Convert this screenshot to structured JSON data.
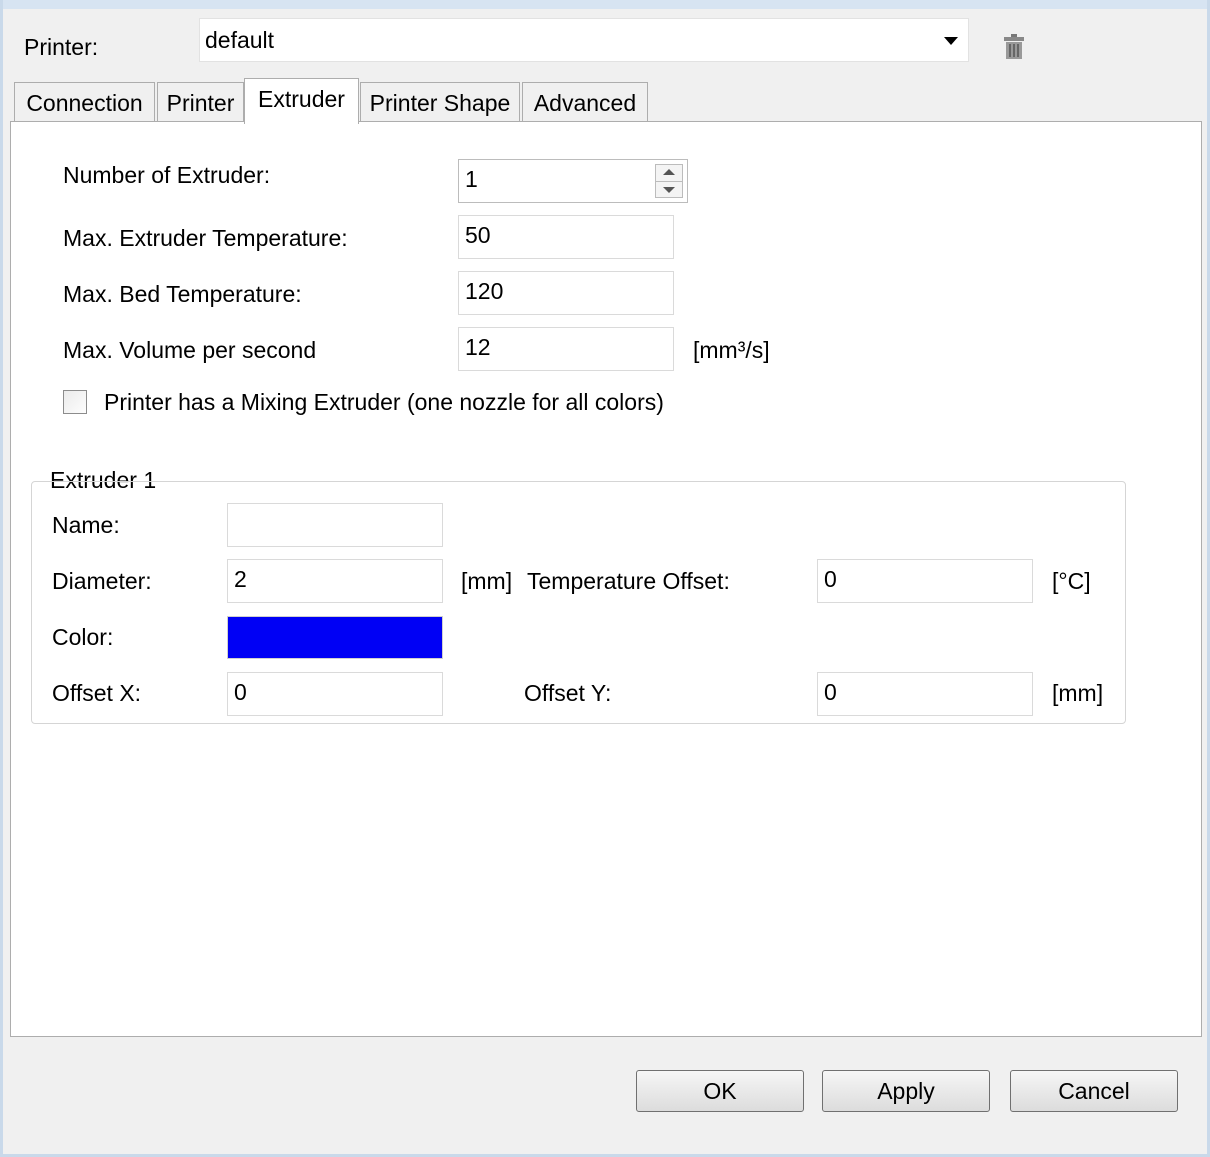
{
  "printer": {
    "label": "Printer:",
    "selected": "default",
    "delete_icon": "trash-icon"
  },
  "tabs": [
    {
      "label": "Connection"
    },
    {
      "label": "Printer"
    },
    {
      "label": "Extruder",
      "active": true
    },
    {
      "label": "Printer Shape"
    },
    {
      "label": "Advanced"
    }
  ],
  "extruder": {
    "num_label": "Number of Extruder:",
    "num_value": "1",
    "max_extruder_temp_label": "Max. Extruder Temperature:",
    "max_extruder_temp_value": "50",
    "max_bed_temp_label": "Max. Bed Temperature:",
    "max_bed_temp_value": "120",
    "max_volume_label": "Max. Volume per second",
    "max_volume_value": "12",
    "max_volume_unit": "[mm³/s]",
    "mixing_label": "Printer has a Mixing Extruder (one nozzle for all colors)",
    "mixing_checked": false
  },
  "extruder1": {
    "title": "Extruder 1",
    "name_label": "Name:",
    "name_value": "",
    "diameter_label": "Diameter:",
    "diameter_value": "2",
    "diameter_unit": "[mm]",
    "temp_offset_label": "Temperature Offset:",
    "temp_offset_value": "0",
    "temp_offset_unit": "[°C]",
    "color_label": "Color:",
    "color_value": "#0000f5",
    "offset_x_label": "Offset X:",
    "offset_x_value": "0",
    "offset_y_label": "Offset Y:",
    "offset_y_value": "0",
    "offset_unit": "[mm]"
  },
  "buttons": {
    "ok": "OK",
    "apply": "Apply",
    "cancel": "Cancel"
  }
}
